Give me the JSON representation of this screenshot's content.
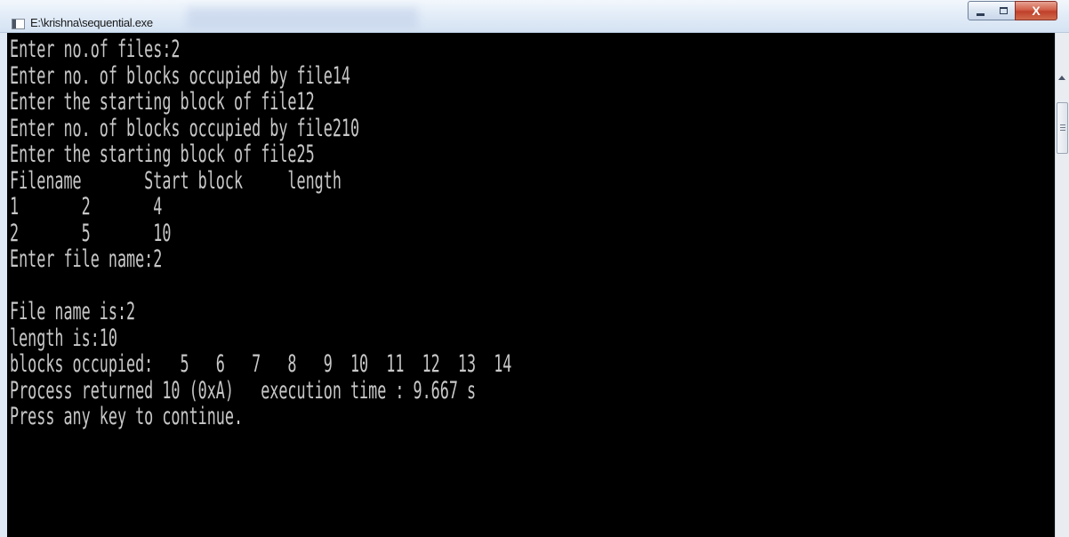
{
  "window": {
    "title": "E:\\krishna\\sequential.exe",
    "icon": "console-app-icon",
    "controls": {
      "minimize_icon": "minimize-icon",
      "maximize_icon": "maximize-icon",
      "close_label": "X"
    }
  },
  "console": {
    "background": "#000000",
    "text_color": "#c8c8c8",
    "lines": [
      "Enter no.of files:2",
      "Enter no. of blocks occupied by file14",
      "Enter the starting block of file12",
      "Enter no. of blocks occupied by file210",
      "Enter the starting block of file25",
      "Filename       Start block     length",
      "1       2       4",
      "2       5       10",
      "Enter file name:2",
      "",
      "File name is:2",
      "length is:10",
      "blocks occupied:   5   6   7   8   9  10  11  12  13  14",
      "Process returned 10 (0xA)   execution time : 9.667 s",
      "Press any key to continue."
    ]
  },
  "scrollbar": {
    "up_icon": "scroll-up-arrow-icon"
  }
}
